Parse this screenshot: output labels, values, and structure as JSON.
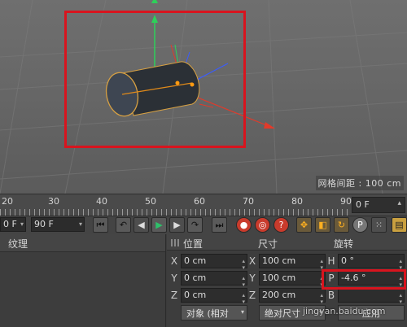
{
  "viewport": {
    "grid_spacing_label": "网格间距 : 100 cm"
  },
  "timeline": {
    "ticks": [
      "20",
      "30",
      "40",
      "50",
      "60",
      "70",
      "80",
      "90"
    ],
    "end_frame_display": "0 F"
  },
  "transport": {
    "start_field": "0 F",
    "end_field": "90 F"
  },
  "left_panel": {
    "title": "纹理"
  },
  "coords": {
    "headers": {
      "position": "位置",
      "size": "尺寸",
      "rotation": "旋转"
    },
    "rows": [
      {
        "pos_axis": "X",
        "pos_value": "0 cm",
        "size_axis": "X",
        "size_value": "100 cm",
        "rot_axis": "H",
        "rot_value": "0 °"
      },
      {
        "pos_axis": "Y",
        "pos_value": "0 cm",
        "size_axis": "Y",
        "size_value": "100 cm",
        "rot_axis": "P",
        "rot_value": "-4.6 °"
      },
      {
        "pos_axis": "Z",
        "pos_value": "0 cm",
        "size_axis": "Z",
        "size_value": "200 cm",
        "rot_axis": "B",
        "rot_value": ""
      }
    ],
    "object_mode_button": "对象 (相对",
    "absolute_size_button": "绝对尺寸",
    "apply_button": "应用"
  },
  "watermark": "jingyan.baidu.com",
  "colors": {
    "highlight": "#d8141e",
    "axis_x": "#e23a2a",
    "axis_y": "#2ed05a",
    "axis_z": "#3a5cff"
  }
}
